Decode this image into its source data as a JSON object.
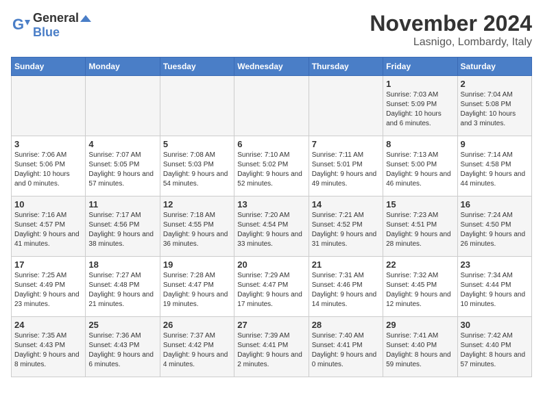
{
  "logo": {
    "general": "General",
    "blue": "Blue"
  },
  "title": "November 2024",
  "subtitle": "Lasnigo, Lombardy, Italy",
  "headers": [
    "Sunday",
    "Monday",
    "Tuesday",
    "Wednesday",
    "Thursday",
    "Friday",
    "Saturday"
  ],
  "weeks": [
    [
      {
        "day": "",
        "info": ""
      },
      {
        "day": "",
        "info": ""
      },
      {
        "day": "",
        "info": ""
      },
      {
        "day": "",
        "info": ""
      },
      {
        "day": "",
        "info": ""
      },
      {
        "day": "1",
        "info": "Sunrise: 7:03 AM\nSunset: 5:09 PM\nDaylight: 10 hours and 6 minutes."
      },
      {
        "day": "2",
        "info": "Sunrise: 7:04 AM\nSunset: 5:08 PM\nDaylight: 10 hours and 3 minutes."
      }
    ],
    [
      {
        "day": "3",
        "info": "Sunrise: 7:06 AM\nSunset: 5:06 PM\nDaylight: 10 hours and 0 minutes."
      },
      {
        "day": "4",
        "info": "Sunrise: 7:07 AM\nSunset: 5:05 PM\nDaylight: 9 hours and 57 minutes."
      },
      {
        "day": "5",
        "info": "Sunrise: 7:08 AM\nSunset: 5:03 PM\nDaylight: 9 hours and 54 minutes."
      },
      {
        "day": "6",
        "info": "Sunrise: 7:10 AM\nSunset: 5:02 PM\nDaylight: 9 hours and 52 minutes."
      },
      {
        "day": "7",
        "info": "Sunrise: 7:11 AM\nSunset: 5:01 PM\nDaylight: 9 hours and 49 minutes."
      },
      {
        "day": "8",
        "info": "Sunrise: 7:13 AM\nSunset: 5:00 PM\nDaylight: 9 hours and 46 minutes."
      },
      {
        "day": "9",
        "info": "Sunrise: 7:14 AM\nSunset: 4:58 PM\nDaylight: 9 hours and 44 minutes."
      }
    ],
    [
      {
        "day": "10",
        "info": "Sunrise: 7:16 AM\nSunset: 4:57 PM\nDaylight: 9 hours and 41 minutes."
      },
      {
        "day": "11",
        "info": "Sunrise: 7:17 AM\nSunset: 4:56 PM\nDaylight: 9 hours and 38 minutes."
      },
      {
        "day": "12",
        "info": "Sunrise: 7:18 AM\nSunset: 4:55 PM\nDaylight: 9 hours and 36 minutes."
      },
      {
        "day": "13",
        "info": "Sunrise: 7:20 AM\nSunset: 4:54 PM\nDaylight: 9 hours and 33 minutes."
      },
      {
        "day": "14",
        "info": "Sunrise: 7:21 AM\nSunset: 4:52 PM\nDaylight: 9 hours and 31 minutes."
      },
      {
        "day": "15",
        "info": "Sunrise: 7:23 AM\nSunset: 4:51 PM\nDaylight: 9 hours and 28 minutes."
      },
      {
        "day": "16",
        "info": "Sunrise: 7:24 AM\nSunset: 4:50 PM\nDaylight: 9 hours and 26 minutes."
      }
    ],
    [
      {
        "day": "17",
        "info": "Sunrise: 7:25 AM\nSunset: 4:49 PM\nDaylight: 9 hours and 23 minutes."
      },
      {
        "day": "18",
        "info": "Sunrise: 7:27 AM\nSunset: 4:48 PM\nDaylight: 9 hours and 21 minutes."
      },
      {
        "day": "19",
        "info": "Sunrise: 7:28 AM\nSunset: 4:47 PM\nDaylight: 9 hours and 19 minutes."
      },
      {
        "day": "20",
        "info": "Sunrise: 7:29 AM\nSunset: 4:47 PM\nDaylight: 9 hours and 17 minutes."
      },
      {
        "day": "21",
        "info": "Sunrise: 7:31 AM\nSunset: 4:46 PM\nDaylight: 9 hours and 14 minutes."
      },
      {
        "day": "22",
        "info": "Sunrise: 7:32 AM\nSunset: 4:45 PM\nDaylight: 9 hours and 12 minutes."
      },
      {
        "day": "23",
        "info": "Sunrise: 7:34 AM\nSunset: 4:44 PM\nDaylight: 9 hours and 10 minutes."
      }
    ],
    [
      {
        "day": "24",
        "info": "Sunrise: 7:35 AM\nSunset: 4:43 PM\nDaylight: 9 hours and 8 minutes."
      },
      {
        "day": "25",
        "info": "Sunrise: 7:36 AM\nSunset: 4:43 PM\nDaylight: 9 hours and 6 minutes."
      },
      {
        "day": "26",
        "info": "Sunrise: 7:37 AM\nSunset: 4:42 PM\nDaylight: 9 hours and 4 minutes."
      },
      {
        "day": "27",
        "info": "Sunrise: 7:39 AM\nSunset: 4:41 PM\nDaylight: 9 hours and 2 minutes."
      },
      {
        "day": "28",
        "info": "Sunrise: 7:40 AM\nSunset: 4:41 PM\nDaylight: 9 hours and 0 minutes."
      },
      {
        "day": "29",
        "info": "Sunrise: 7:41 AM\nSunset: 4:40 PM\nDaylight: 8 hours and 59 minutes."
      },
      {
        "day": "30",
        "info": "Sunrise: 7:42 AM\nSunset: 4:40 PM\nDaylight: 8 hours and 57 minutes."
      }
    ]
  ]
}
